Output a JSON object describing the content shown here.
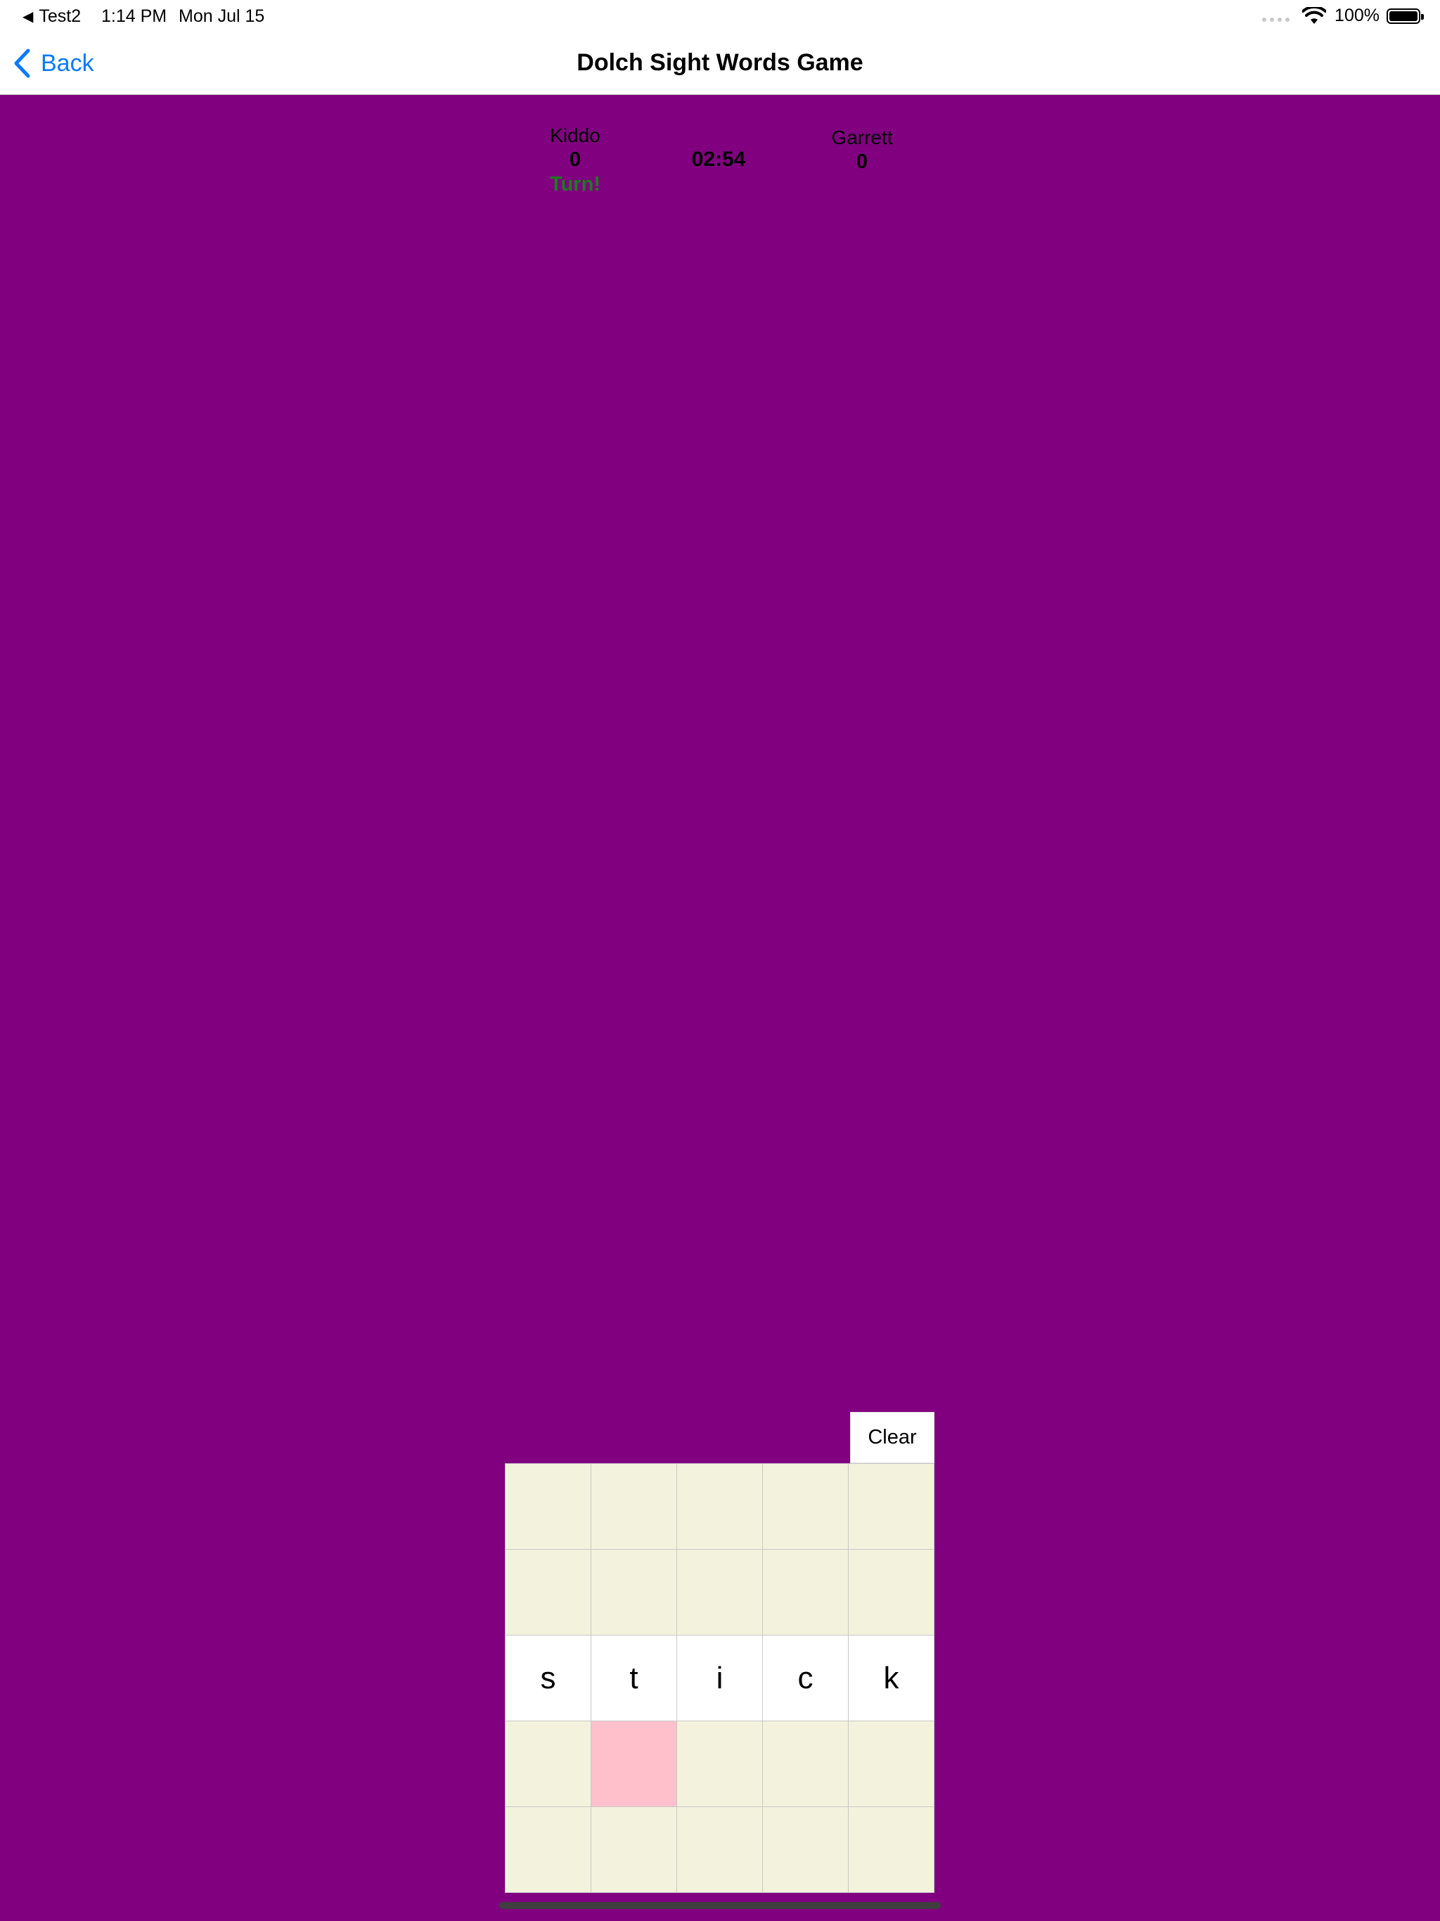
{
  "status_bar": {
    "back_app": "Test2",
    "time": "1:14 PM",
    "date": "Mon Jul 15",
    "battery": "100%"
  },
  "nav": {
    "back_label": "Back",
    "title": "Dolch Sight Words Game"
  },
  "players": [
    {
      "name": "Kiddo",
      "score": "0",
      "turn": "Turn!"
    },
    {
      "name": "Garrett",
      "score": "0"
    }
  ],
  "timer": "02:54",
  "clear_label": "Clear",
  "grid": [
    [
      "",
      "",
      "",
      "",
      ""
    ],
    [
      "",
      "",
      "",
      "",
      ""
    ],
    [
      "s",
      "t",
      "i",
      "c",
      "k"
    ],
    [
      "",
      "",
      "",
      "",
      ""
    ],
    [
      "",
      "",
      "",
      "",
      ""
    ]
  ],
  "colors": {
    "background": "#800080",
    "empty_cell": "#f3f2dc",
    "letter_cell": "#ffffff",
    "highlight_cell": "#ffc0cb",
    "turn_text": "#1f7a1f",
    "link": "#0a7aff"
  }
}
